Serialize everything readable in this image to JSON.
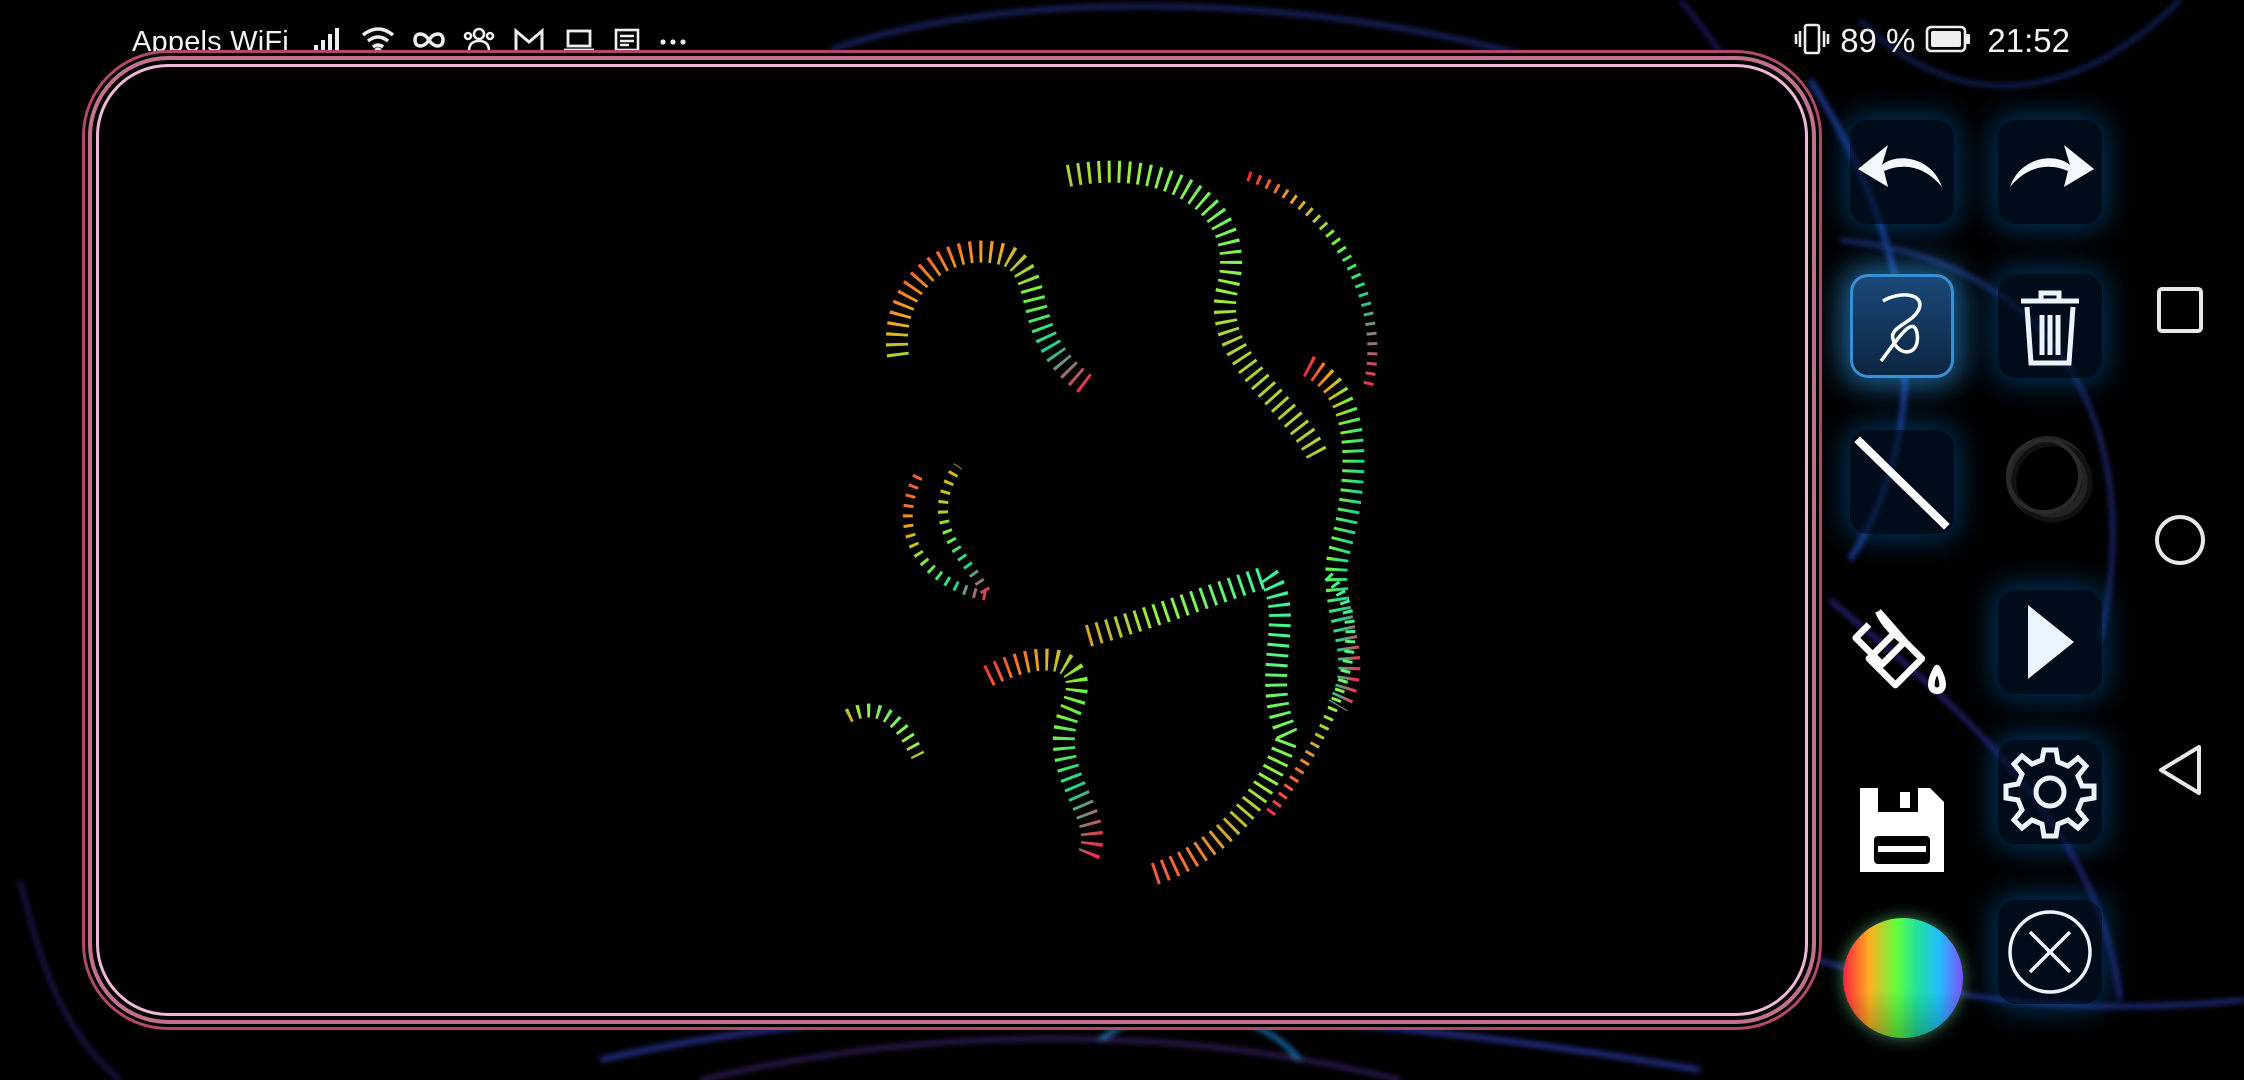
{
  "status_bar": {
    "carrier": "Appels WiFi",
    "battery_percent": "89 %",
    "time": "21:52",
    "icons": [
      "signal-icon",
      "wifi-icon",
      "infinity-icon",
      "group-icon",
      "gmail-icon",
      "laptop-icon",
      "news-icon",
      "more-dots-icon",
      "vibrate-icon",
      "battery-icon"
    ]
  },
  "colors": {
    "frame_outer": "#b04868",
    "frame_inner": "#f0b8d8",
    "tool_glow": "#2896e6",
    "background": "#000000"
  },
  "toolbar": {
    "tools": [
      {
        "name": "undo",
        "icon": "undo-icon"
      },
      {
        "name": "redo",
        "icon": "redo-icon"
      },
      {
        "name": "freehand",
        "icon": "freehand-icon",
        "active": true
      },
      {
        "name": "delete",
        "icon": "trash-icon"
      },
      {
        "name": "line",
        "icon": "line-icon"
      },
      {
        "name": "circle",
        "icon": "circle-icon",
        "disabled": true
      },
      {
        "name": "fill",
        "icon": "paint-bucket-icon"
      },
      {
        "name": "play",
        "icon": "play-icon"
      },
      {
        "name": "save",
        "icon": "floppy-disk-icon"
      },
      {
        "name": "settings",
        "icon": "gear-icon"
      },
      {
        "name": "color",
        "icon": "color-wheel-icon"
      },
      {
        "name": "close",
        "icon": "close-circle-icon"
      }
    ]
  },
  "nav_bar": {
    "buttons": [
      "recents-square-icon",
      "home-circle-icon",
      "back-triangle-icon"
    ]
  }
}
